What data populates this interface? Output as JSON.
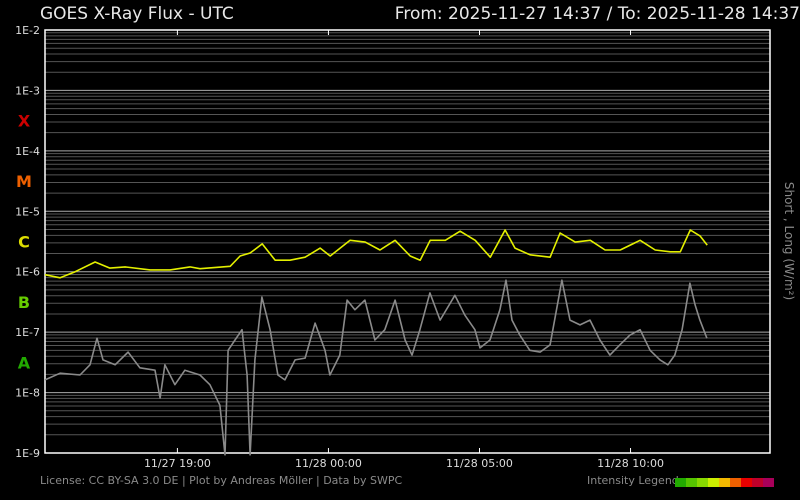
{
  "header": {
    "title": "GOES X-Ray Flux - UTC",
    "range": "From: 2025-11-27 14:37  /  To: 2025-11-28 14:37"
  },
  "footer": {
    "text": "License: CC BY-SA 3.0 DE | Plot by Andreas Möller | Data by SWPC",
    "legend_label": "Intensity Legend",
    "legend_colors": [
      "#22aa00",
      "#55c400",
      "#88d800",
      "#ccee00",
      "#f2b800",
      "#ee6000",
      "#e80000",
      "#c0002a",
      "#a8005a"
    ]
  },
  "chart_data": {
    "type": "line",
    "title": "GOES X-Ray Flux - UTC",
    "ylabel": "Short , Long (W/m²)",
    "yscale": "log",
    "ylim_exp": [
      -9,
      -2
    ],
    "ytick_labels": [
      "1E-2",
      "1E-3",
      "1E-4",
      "1E-5",
      "1E-6",
      "1E-7",
      "1E-8",
      "1E-9"
    ],
    "xlim_hours": [
      0,
      24
    ],
    "xticks": [
      {
        "h": 4.383,
        "label": "11/27 19:00"
      },
      {
        "h": 9.383,
        "label": "11/28 00:00"
      },
      {
        "h": 14.383,
        "label": "11/28 05:00"
      },
      {
        "h": 19.383,
        "label": "11/28 10:00"
      }
    ],
    "classes": [
      {
        "label": "X",
        "exp": -3.5,
        "color": "#cc0000"
      },
      {
        "label": "M",
        "exp": -4.5,
        "color": "#ee6000"
      },
      {
        "label": "C",
        "exp": -5.5,
        "color": "#dddd00"
      },
      {
        "label": "B",
        "exp": -6.5,
        "color": "#66cc00"
      },
      {
        "label": "A",
        "exp": -7.5,
        "color": "#22aa00"
      }
    ],
    "grid": true,
    "series": [
      {
        "name": "Long",
        "color": "#e4f000",
        "points": [
          [
            0,
            -6.05
          ],
          [
            0.5,
            -6.1
          ],
          [
            1,
            -6.0
          ],
          [
            1.66,
            -5.84
          ],
          [
            2.15,
            -5.94
          ],
          [
            2.65,
            -5.92
          ],
          [
            3.48,
            -5.97
          ],
          [
            4.14,
            -5.97
          ],
          [
            4.8,
            -5.92
          ],
          [
            5.13,
            -5.95
          ],
          [
            6.13,
            -5.91
          ],
          [
            6.46,
            -5.74
          ],
          [
            6.79,
            -5.69
          ],
          [
            7.19,
            -5.54
          ],
          [
            7.62,
            -5.81
          ],
          [
            8.11,
            -5.81
          ],
          [
            8.61,
            -5.76
          ],
          [
            9.11,
            -5.61
          ],
          [
            9.44,
            -5.74
          ],
          [
            10.1,
            -5.48
          ],
          [
            10.6,
            -5.51
          ],
          [
            11.09,
            -5.64
          ],
          [
            11.59,
            -5.48
          ],
          [
            12.09,
            -5.74
          ],
          [
            12.42,
            -5.81
          ],
          [
            12.75,
            -5.48
          ],
          [
            13.25,
            -5.48
          ],
          [
            13.74,
            -5.33
          ],
          [
            14.24,
            -5.48
          ],
          [
            14.74,
            -5.76
          ],
          [
            15.23,
            -5.31
          ],
          [
            15.56,
            -5.61
          ],
          [
            16.06,
            -5.72
          ],
          [
            16.72,
            -5.76
          ],
          [
            17.05,
            -5.36
          ],
          [
            17.55,
            -5.51
          ],
          [
            18.05,
            -5.48
          ],
          [
            18.54,
            -5.64
          ],
          [
            19.04,
            -5.64
          ],
          [
            19.7,
            -5.48
          ],
          [
            20.2,
            -5.64
          ],
          [
            20.7,
            -5.67
          ],
          [
            21.03,
            -5.67
          ],
          [
            21.36,
            -5.31
          ],
          [
            21.69,
            -5.41
          ],
          [
            21.92,
            -5.56
          ]
        ]
      },
      {
        "name": "Short",
        "color": "#8a8a8a",
        "points": [
          [
            0,
            -7.79
          ],
          [
            0.5,
            -7.68
          ],
          [
            1.16,
            -7.71
          ],
          [
            1.49,
            -7.54
          ],
          [
            1.72,
            -7.1
          ],
          [
            1.92,
            -7.46
          ],
          [
            2.32,
            -7.54
          ],
          [
            2.75,
            -7.33
          ],
          [
            3.14,
            -7.59
          ],
          [
            3.64,
            -7.63
          ],
          [
            3.81,
            -8.09
          ],
          [
            3.97,
            -7.54
          ],
          [
            4.3,
            -7.87
          ],
          [
            4.63,
            -7.63
          ],
          [
            5.13,
            -7.71
          ],
          [
            5.46,
            -7.87
          ],
          [
            5.79,
            -8.21
          ],
          [
            5.96,
            -9.03
          ],
          [
            6.06,
            -7.3
          ],
          [
            6.29,
            -7.13
          ],
          [
            6.52,
            -6.96
          ],
          [
            6.69,
            -7.71
          ],
          [
            6.79,
            -9.03
          ],
          [
            6.95,
            -7.46
          ],
          [
            7.18,
            -6.42
          ],
          [
            7.45,
            -6.96
          ],
          [
            7.71,
            -7.71
          ],
          [
            7.94,
            -7.79
          ],
          [
            8.28,
            -7.46
          ],
          [
            8.61,
            -7.43
          ],
          [
            8.94,
            -6.85
          ],
          [
            9.27,
            -7.3
          ],
          [
            9.43,
            -7.71
          ],
          [
            9.76,
            -7.38
          ],
          [
            10.0,
            -6.47
          ],
          [
            10.26,
            -6.63
          ],
          [
            10.59,
            -6.47
          ],
          [
            10.92,
            -7.13
          ],
          [
            11.25,
            -6.96
          ],
          [
            11.59,
            -6.47
          ],
          [
            11.92,
            -7.13
          ],
          [
            12.15,
            -7.38
          ],
          [
            12.41,
            -6.96
          ],
          [
            12.74,
            -6.35
          ],
          [
            13.08,
            -6.8
          ],
          [
            13.57,
            -6.39
          ],
          [
            13.9,
            -6.72
          ],
          [
            14.23,
            -6.96
          ],
          [
            14.4,
            -7.26
          ],
          [
            14.73,
            -7.13
          ],
          [
            15.06,
            -6.63
          ],
          [
            15.26,
            -6.14
          ],
          [
            15.46,
            -6.8
          ],
          [
            15.72,
            -7.05
          ],
          [
            16.05,
            -7.3
          ],
          [
            16.39,
            -7.33
          ],
          [
            16.72,
            -7.21
          ],
          [
            17.11,
            -6.14
          ],
          [
            17.38,
            -6.8
          ],
          [
            17.71,
            -6.88
          ],
          [
            18.04,
            -6.8
          ],
          [
            18.37,
            -7.13
          ],
          [
            18.7,
            -7.38
          ],
          [
            19.03,
            -7.21
          ],
          [
            19.36,
            -7.05
          ],
          [
            19.7,
            -6.96
          ],
          [
            20.03,
            -7.3
          ],
          [
            20.36,
            -7.46
          ],
          [
            20.62,
            -7.54
          ],
          [
            20.85,
            -7.38
          ],
          [
            21.09,
            -6.96
          ],
          [
            21.35,
            -6.19
          ],
          [
            21.52,
            -6.55
          ],
          [
            21.68,
            -6.8
          ],
          [
            21.91,
            -7.1
          ]
        ]
      }
    ]
  }
}
